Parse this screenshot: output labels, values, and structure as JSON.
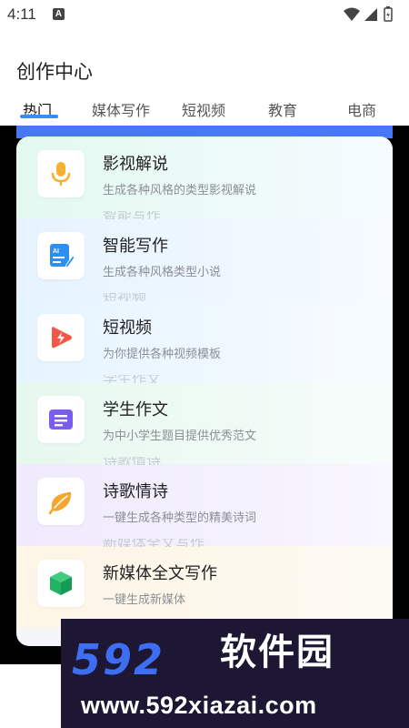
{
  "status_bar": {
    "time": "4:11",
    "notification_letter": "A",
    "icons": [
      "wifi-icon",
      "signal-icon",
      "battery-icon"
    ]
  },
  "page": {
    "title": "创作中心"
  },
  "tabs": [
    {
      "label": "热门",
      "active": true
    },
    {
      "label": "媒体写作",
      "active": false
    },
    {
      "label": "短视频",
      "active": false
    },
    {
      "label": "教育",
      "active": false
    },
    {
      "label": "电商",
      "active": false
    }
  ],
  "cards": [
    {
      "title": "影视解说",
      "subtitle": "生成各种风格的类型影视解说",
      "icon": "microphone-icon",
      "color": "#f5b135",
      "ghost": ""
    },
    {
      "title": "智能写作",
      "subtitle": "生成各种风格类型小说",
      "icon": "ai-write-icon",
      "color": "#2f8ff0",
      "ghost": "智能写作"
    },
    {
      "title": "短视频",
      "subtitle": "为你提供各种视频模板",
      "icon": "play-icon",
      "color": "#f5564a",
      "ghost": "短视频"
    },
    {
      "title": "学生作文",
      "subtitle": "为中小学生题目提供优秀范文",
      "icon": "document-icon",
      "color": "#7b5cf0",
      "ghost": "学生作文"
    },
    {
      "title": "诗歌情诗",
      "subtitle": "一键生成各种类型的精美诗词",
      "icon": "leaf-icon",
      "color": "#f4a62f",
      "ghost": "诗歌情诗"
    },
    {
      "title": "新媒体全文写作",
      "subtitle": "一键生成新媒体",
      "icon": "cube-icon",
      "color": "#1fb364",
      "ghost": "新媒体全文写作"
    }
  ],
  "watermark": {
    "number": "592",
    "name": "软件园",
    "url": "www.592xiazai.com"
  }
}
